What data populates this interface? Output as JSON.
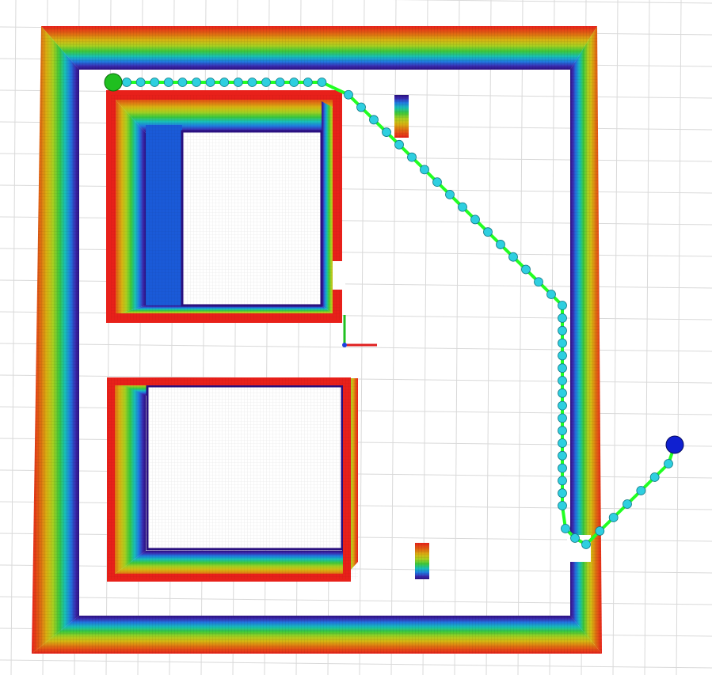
{
  "scene": {
    "background": "#ffffff",
    "grid_color": "#d9d9d9",
    "path_color": "#22ff22",
    "waypoint_color": "#2ecfe0",
    "start_marker_color": "#1fbf1f",
    "goal_marker_color": "#1020d0",
    "axis_x_color": "#e02020",
    "axis_y_color": "#20c020",
    "axis_z_color": "#2040e0",
    "heightmap_gradient": [
      "#e8201a",
      "#e06a12",
      "#d8b412",
      "#a8d020",
      "#3cc83c",
      "#18c0b8",
      "#2078e0",
      "#3b2bb0",
      "#2a1080"
    ]
  }
}
